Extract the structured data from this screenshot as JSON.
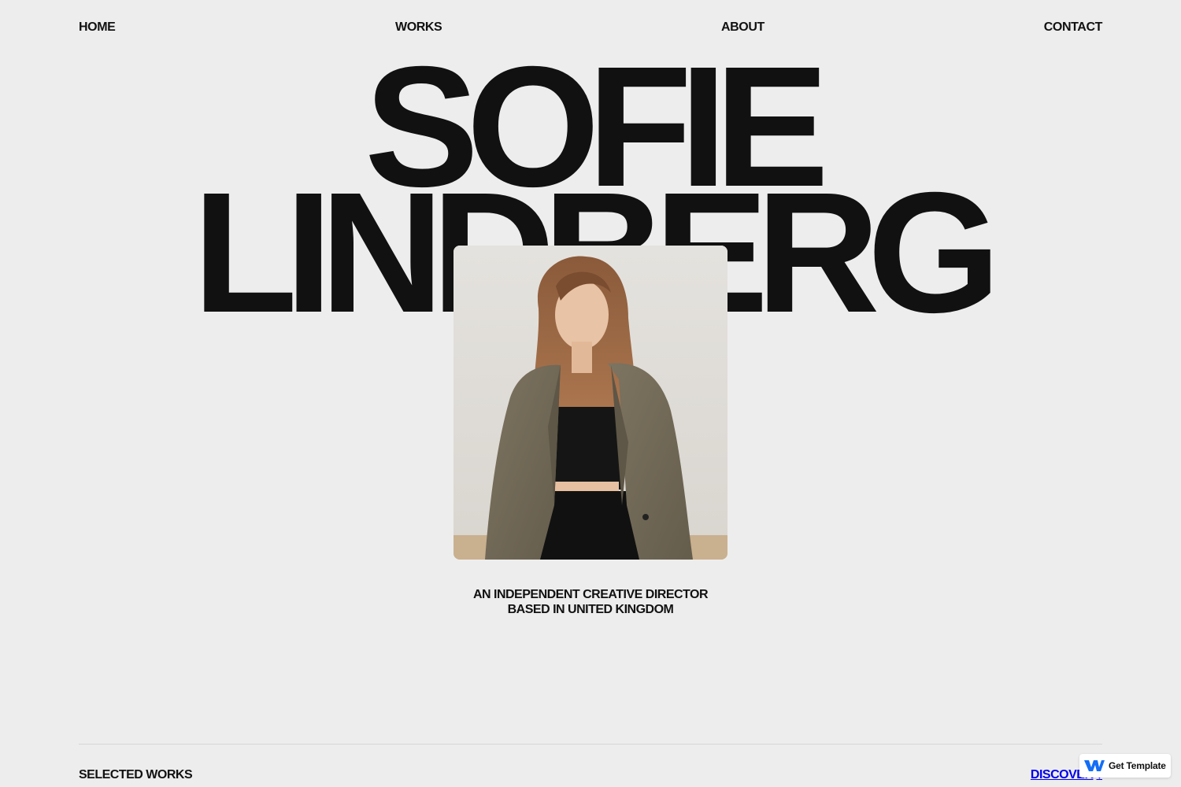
{
  "nav": {
    "home": "HOME",
    "works": "WORKS",
    "about": "ABOUT",
    "contact": "CONTACT"
  },
  "hero": {
    "first_name": "SOFIE",
    "last_name": "LINDBERG"
  },
  "portrait": {
    "alt": "Portrait of Sofie Lindberg"
  },
  "tagline": {
    "line1": "AN INDEPENDENT CREATIVE DIRECTOR",
    "line2": "BASED IN UNITED KINGDOM"
  },
  "footer": {
    "selected_works": "SELECTED WORKS",
    "discover": "DISCOVER",
    "discover_icon": "arrow-down-icon"
  },
  "badge": {
    "label": "Get Template",
    "icon": "webflow-logo-icon",
    "color": "#146ef5"
  },
  "colors": {
    "background": "#ededed",
    "text": "#111111"
  }
}
